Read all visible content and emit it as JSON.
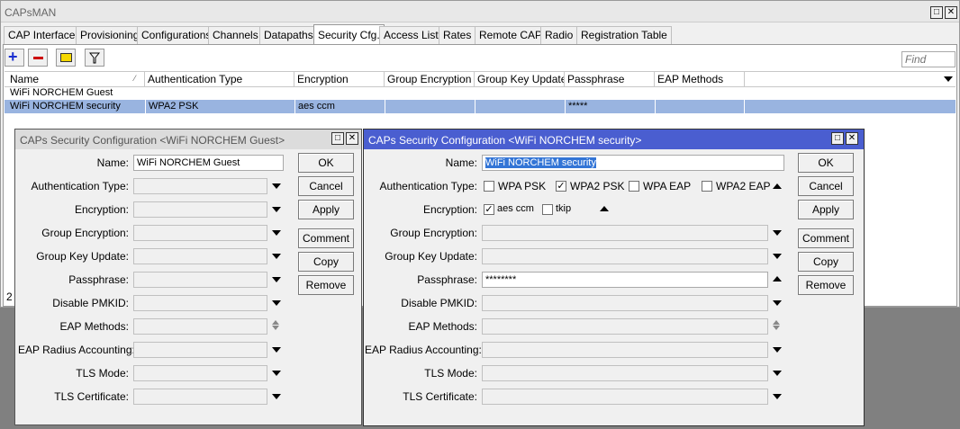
{
  "app_title": "CAPsMAN",
  "tabs": [
    "CAP Interface",
    "Provisioning",
    "Configurations",
    "Channels",
    "Datapaths",
    "Security Cfg.",
    "Access List",
    "Rates",
    "Remote CAP",
    "Radio",
    "Registration Table"
  ],
  "toolbar": {
    "find_placeholder": "Find"
  },
  "table": {
    "columns": [
      "Name",
      "Authentication Type",
      "Encryption",
      "Group Encryption",
      "Group Key Update",
      "Passphrase",
      "EAP Methods"
    ],
    "rows": [
      {
        "name": "WiFi NORCHEM Guest",
        "auth": "",
        "enc": "",
        "genc": "",
        "gku": "",
        "pass": "",
        "eap": ""
      },
      {
        "name": "WiFi NORCHEM security",
        "auth": "WPA2 PSK",
        "enc": "aes ccm",
        "genc": "",
        "gku": "",
        "pass": "*****",
        "eap": ""
      }
    ],
    "status_count": "2"
  },
  "labels": {
    "name": "Name:",
    "auth": "Authentication Type:",
    "enc": "Encryption:",
    "genc": "Group Encryption:",
    "gku": "Group Key Update:",
    "pass": "Passphrase:",
    "pmkid": "Disable PMKID:",
    "eap": "EAP Methods:",
    "radius": "EAP Radius Accounting:",
    "tls": "TLS Mode:",
    "cert": "TLS Certificate:"
  },
  "buttons": {
    "ok": "OK",
    "cancel": "Cancel",
    "apply": "Apply",
    "comment": "Comment",
    "copy": "Copy",
    "remove": "Remove"
  },
  "dialog_guest": {
    "title": "CAPs Security Configuration <WiFi NORCHEM Guest>",
    "name_value": "WiFi NORCHEM Guest"
  },
  "dialog_security": {
    "title": "CAPs Security Configuration <WiFi NORCHEM security>",
    "name_value": "WiFi NORCHEM security",
    "auth_options": [
      {
        "label": "WPA PSK",
        "checked": false
      },
      {
        "label": "WPA2 PSK",
        "checked": true
      },
      {
        "label": "WPA EAP",
        "checked": false
      },
      {
        "label": "WPA2 EAP",
        "checked": false
      }
    ],
    "enc_options": [
      {
        "label": "aes ccm",
        "checked": true
      },
      {
        "label": "tkip",
        "checked": false
      }
    ],
    "passphrase_value": "********"
  },
  "colors": {
    "title_active": "#4a5ed0",
    "selection": "#99b4e0"
  }
}
